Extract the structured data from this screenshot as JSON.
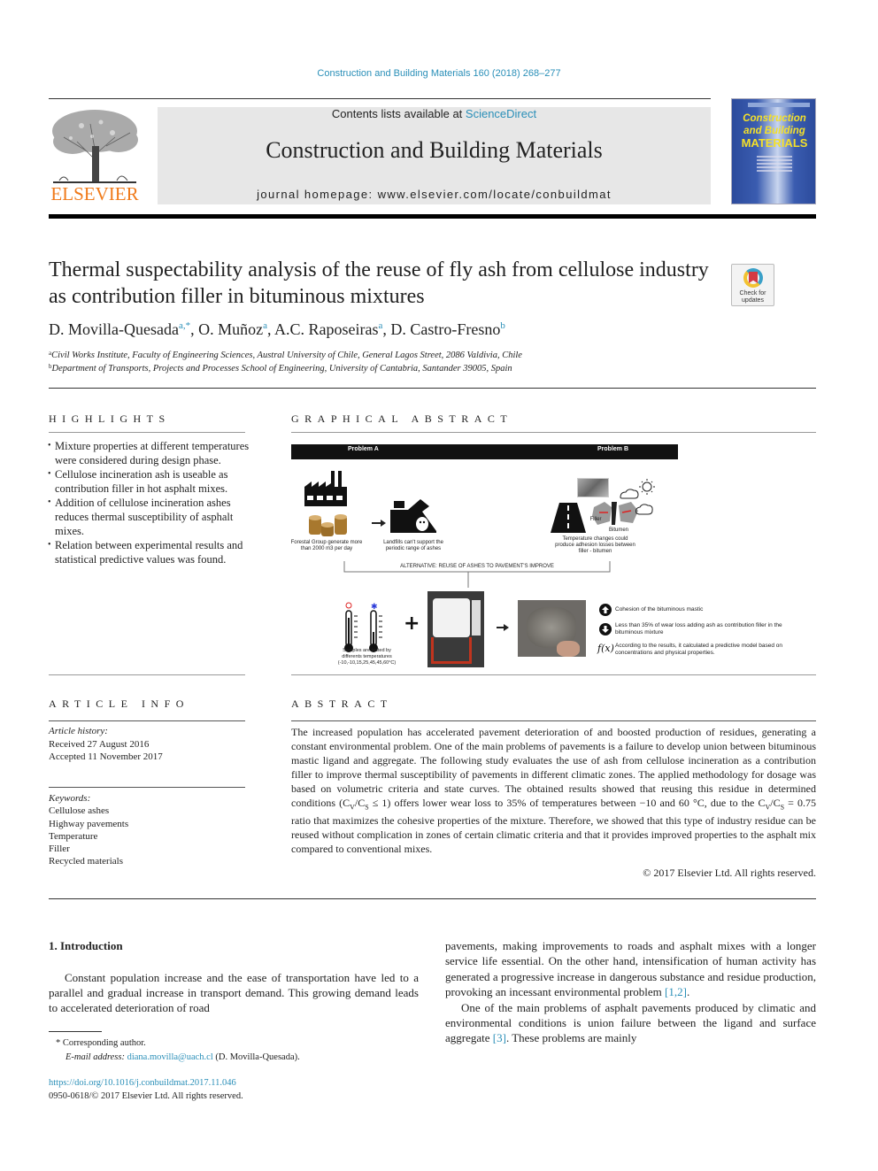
{
  "header": {
    "journal_ref": "Construction and Building Materials 160 (2018) 268–277",
    "contents_prefix": "Contents lists available at ",
    "contents_link": "ScienceDirect",
    "journal_name": "Construction and Building Materials",
    "homepage": "journal homepage: www.elsevier.com/locate/conbuildmat",
    "publisher_logo_text": "ELSEVIER",
    "cover": {
      "line1": "Construction",
      "line2": "and Building",
      "line3": "MATERIALS"
    }
  },
  "article": {
    "title": "Thermal suspectability analysis of the reuse of fly ash from cellulose industry as contribution filler in bituminous mixtures",
    "crossmark": "Check for updates",
    "authors": [
      {
        "name": "D. Movilla-Quesada",
        "sup": "a,*"
      },
      {
        "name": "O. Muñoz",
        "sup": "a"
      },
      {
        "name": "A.C. Raposeiras",
        "sup": "a"
      },
      {
        "name": "D. Castro-Fresno",
        "sup": "b"
      }
    ],
    "affiliations": [
      {
        "sup": "a",
        "text": "Civil Works Institute, Faculty of Engineering Sciences, Austral University of Chile, General Lagos Street, 2086 Valdivia, Chile"
      },
      {
        "sup": "b",
        "text": "Department of Transports, Projects and Processes School of Engineering, University of Cantabria, Santander 39005, Spain"
      }
    ]
  },
  "highlights": {
    "heading": "HIGHLIGHTS",
    "items": [
      "Mixture properties at different temperatures were considered during design phase.",
      "Cellulose incineration ash is useable as contribution filler in hot asphalt mixes.",
      "Addition of cellulose incineration ashes reduces thermal susceptibility of asphalt mixes.",
      "Relation between experimental results and statistical predictive values was found."
    ]
  },
  "graphical_abstract": {
    "heading": "GRAPHICAL ABSTRACT",
    "problem_a": "Problem A",
    "problem_b": "Problem B",
    "forestal": "Forestal Group generate more than 2000 m3 per day",
    "landfill": "Landfills can't support the periodic range of ashes",
    "temp_changes": "Temperature changes could produce adhesion losses between filler - bitumen",
    "filler_label": "Filler",
    "bitumen_label": "Bitumen",
    "alternative": "ALTERNATIVE: REUSE OF ASHES TO PAVEMENT'S IMPROVE",
    "samples": "Samples are tested by differents temperatures (-10,-10,15,25,45,45,60°C)",
    "results": [
      {
        "icon": "arrow-up-circle-icon",
        "text": "Cohesion of the bituminous mastic"
      },
      {
        "icon": "arrow-down-circle-icon",
        "text": "Less than 35% of wear loss adding ash as contribution filler in the bituminous mixture"
      },
      {
        "icon": "function-icon",
        "text": "According to the results, it calculated a predictive model based on concentrations and physical properties."
      }
    ],
    "fx_symbol": "f(x)"
  },
  "article_info": {
    "heading": "ARTICLE INFO",
    "history_label": "Article history:",
    "received": "Received 27 August 2016",
    "accepted": "Accepted 11 November 2017",
    "keywords_label": "Keywords:",
    "keywords": [
      "Cellulose ashes",
      "Highway pavements",
      "Temperature",
      "Filler",
      "Recycled materials"
    ]
  },
  "abstract": {
    "heading": "ABSTRACT",
    "text_1": "The increased population has accelerated pavement deterioration of and boosted production of residues, generating a constant environmental problem. One of the main problems of pavements is a failure to develop union between bituminous mastic ligand and aggregate. The following study evaluates the use of ash from cellulose incineration as a contribution filler to improve thermal susceptibility of pavements in different climatic zones. The applied methodology for dosage was based on volumetric criteria and state curves. The obtained results showed that reusing this residue in determined conditions (C",
    "text_2": "/C",
    "text_3": " ≤ 1) offers lower wear loss to 35% of temperatures between −10 and 60 °C, due to the C",
    "text_4": "/C",
    "text_5": " = 0.75 ratio that maximizes the cohesive properties of the mixture. Therefore, we showed that this type of industry residue can be reused without complication in zones of certain climatic criteria and that it provides improved properties to the asphalt mix compared to conventional mixes.",
    "sub_v": "V",
    "sub_s": "S",
    "copyright": "© 2017 Elsevier Ltd. All rights reserved."
  },
  "introduction": {
    "heading": "1. Introduction",
    "left_para": "Constant population increase and the ease of transportation have led to a parallel and gradual increase in transport demand. This growing demand leads to accelerated deterioration of road",
    "right_para_1": "pavements, making improvements to roads and asphalt mixes with a longer service life essential. On the other hand, intensification of human activity has generated a progressive increase in dangerous substance and residue production, provoking an incessant environmental problem ",
    "ref_1": "[1,2]",
    "right_para_2": "One of the main problems of asphalt pavements produced by climatic and environmental conditions is union failure between the ligand and surface aggregate ",
    "ref_2": "[3]",
    "right_para_2_end": ". These problems are mainly"
  },
  "footnote": {
    "corresponding": "* Corresponding author.",
    "email_label": "E-mail address: ",
    "email": "diana.movilla@uach.cl",
    "email_suffix": " (D. Movilla-Quesada).",
    "doi": "https://doi.org/10.1016/j.conbuildmat.2017.11.046",
    "issn": "0950-0618/© 2017 Elsevier Ltd. All rights reserved."
  }
}
